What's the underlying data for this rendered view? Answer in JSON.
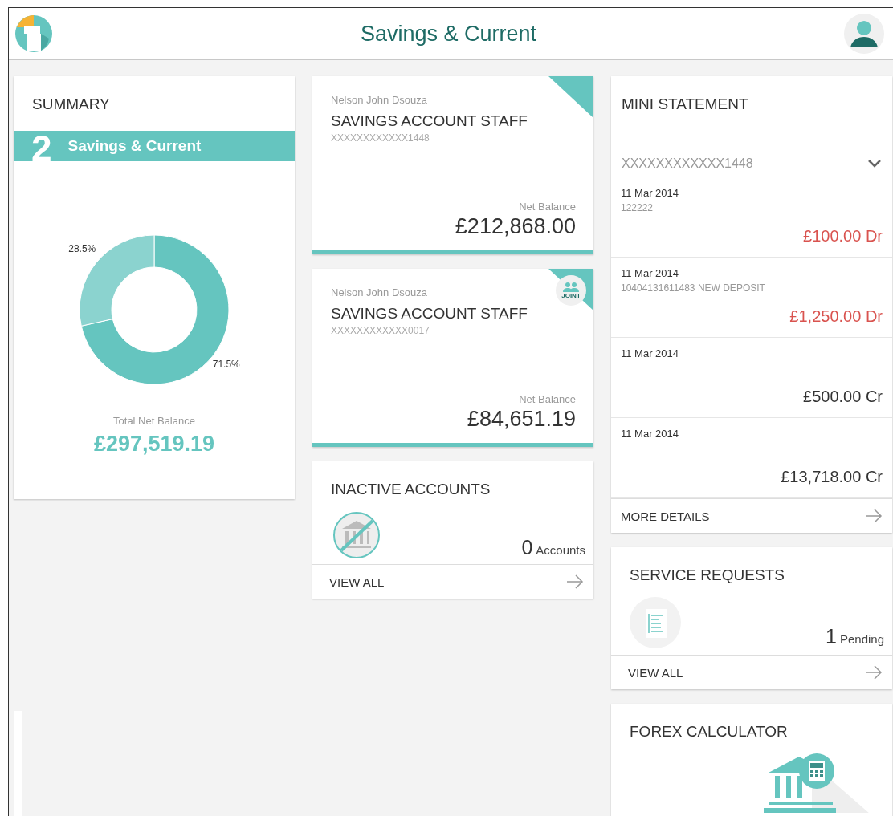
{
  "header": {
    "title": "Savings & Current"
  },
  "summary": {
    "title": "SUMMARY",
    "count": "2",
    "category": "Savings & Current",
    "chart_data": {
      "type": "donut",
      "values": [
        71.5,
        28.5
      ],
      "value_labels": [
        "71.5%",
        "28.5%"
      ]
    },
    "total_label": "Total Net Balance",
    "total": "£297,519.19"
  },
  "accounts": [
    {
      "holder": "Nelson John Dsouza",
      "name": "SAVINGS ACCOUNT STAFF",
      "number": "XXXXXXXXXXXX1448",
      "balance_label": "Net Balance",
      "balance": "£212,868.00",
      "joint": false
    },
    {
      "holder": "Nelson John Dsouza",
      "name": "SAVINGS ACCOUNT STAFF",
      "number": "XXXXXXXXXXXX0017",
      "balance_label": "Net Balance",
      "balance": "£84,651.19",
      "joint": true,
      "badge": "JOINT"
    }
  ],
  "inactive": {
    "title": "INACTIVE ACCOUNTS",
    "count": "0",
    "unit": "Accounts",
    "link": "VIEW ALL"
  },
  "mini_statement": {
    "title": "MINI STATEMENT",
    "account": "XXXXXXXXXXXX1448",
    "rows": [
      {
        "date": "11 Mar 2014",
        "description": "122222",
        "amount": "£100.00 Dr",
        "kind": "debit"
      },
      {
        "date": "11 Mar 2014",
        "description": "10404131611483 NEW DEPOSIT",
        "amount": "£1,250.00 Dr",
        "kind": "debit"
      },
      {
        "date": "11 Mar 2014",
        "amount": "£500.00 Cr",
        "kind": "credit"
      },
      {
        "date": "11 Mar 2014",
        "amount": "£13,718.00 Cr",
        "kind": "credit"
      }
    ],
    "link": "MORE DETAILS"
  },
  "service_requests": {
    "title": "SERVICE REQUESTS",
    "count": "1",
    "unit": "Pending",
    "link": "VIEW ALL"
  },
  "forex": {
    "title": "FOREX CALCULATOR"
  }
}
